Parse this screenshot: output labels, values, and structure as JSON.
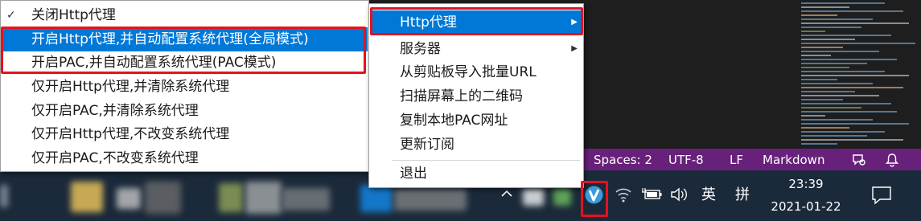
{
  "left_menu": {
    "items": [
      {
        "label": "关闭Http代理",
        "checked": true
      },
      {
        "label": "开启Http代理,并自动配置系统代理(全局模式)",
        "highlighted": true
      },
      {
        "label": "开启PAC,并自动配置系统代理(PAC模式)"
      },
      {
        "label": "仅开启Http代理,并清除系统代理"
      },
      {
        "label": "仅开启PAC,并清除系统代理"
      },
      {
        "label": "仅开启Http代理,不改变系统代理"
      },
      {
        "label": "仅开启PAC,不改变系统代理"
      }
    ]
  },
  "right_menu": {
    "items": [
      {
        "label": "Http代理",
        "has_submenu": true,
        "highlighted": true
      },
      {
        "label": "服务器",
        "has_submenu": true
      },
      {
        "label": "从剪贴板导入批量URL"
      },
      {
        "label": "扫描屏幕上的二维码"
      },
      {
        "label": "复制本地PAC网址"
      },
      {
        "label": "更新订阅"
      },
      {
        "label": "退出"
      }
    ]
  },
  "statusbar": {
    "spaces": "Spaces: 2",
    "encoding": "UTF-8",
    "eol": "LF",
    "language": "Markdown",
    "background": "#68217a"
  },
  "tray": {
    "input_lang": "英",
    "ime": "拼",
    "time": "23:39",
    "date": "2021-01-22"
  },
  "colors": {
    "highlight": "#0078d7",
    "annotation": "#e3121f",
    "taskbar": "#1b2a3a"
  }
}
